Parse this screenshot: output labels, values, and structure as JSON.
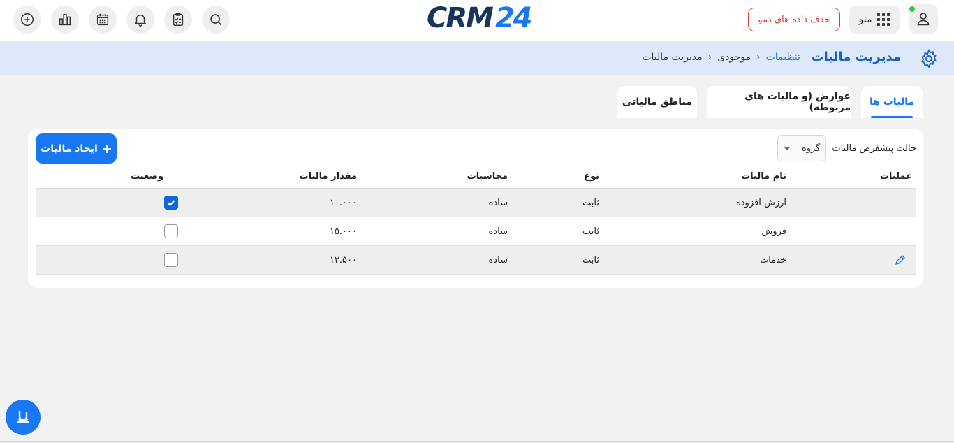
{
  "header": {
    "logo_part1": "CRM",
    "logo_part2": "24",
    "demo_button": "حذف داده های دمو",
    "menu_label": "منو",
    "icons": [
      "add-icon",
      "chart-icon",
      "calendar-icon",
      "bell-icon",
      "clipboard-icon",
      "search-icon",
      "apps-grid-icon",
      "user-icon"
    ]
  },
  "breadcrumb": {
    "page_title": "مدیریت مالیات",
    "items": [
      "تنظیمات",
      "موجودی",
      "مدیریت مالیات"
    ]
  },
  "tabs": [
    {
      "label": "مالیات ها",
      "active": true
    },
    {
      "label": "عوارض (و مالیات های مربوطه)",
      "active": false
    },
    {
      "label": "مناطق مالیاتی",
      "active": false
    }
  ],
  "toolbar": {
    "create_button": "ایجاد مالیات",
    "default_mode_label": "حالت پیشفرض مالیات",
    "default_mode_value": "گروه"
  },
  "table": {
    "columns": [
      "عملیات",
      "نام مالیات",
      "نوع",
      "محاسبات",
      "مقدار مالیات",
      "وضعیت"
    ],
    "rows": [
      {
        "name": "ارزش افزوده",
        "type": "ثابت",
        "calc": "ساده",
        "amount": "۱۰.۰۰۰",
        "status": true
      },
      {
        "name": "فروش",
        "type": "ثابت",
        "calc": "ساده",
        "amount": "۱۵.۰۰۰",
        "status": false
      },
      {
        "name": "خدمات",
        "type": "ثابت",
        "calc": "ساده",
        "amount": "۱۲.۵۰۰",
        "status": false
      }
    ]
  },
  "colors": {
    "accent": "#1877f2",
    "breadcrumb_bg": "#dde9f9",
    "demo_red": "#d62f2f",
    "online": "#2ecc40"
  }
}
